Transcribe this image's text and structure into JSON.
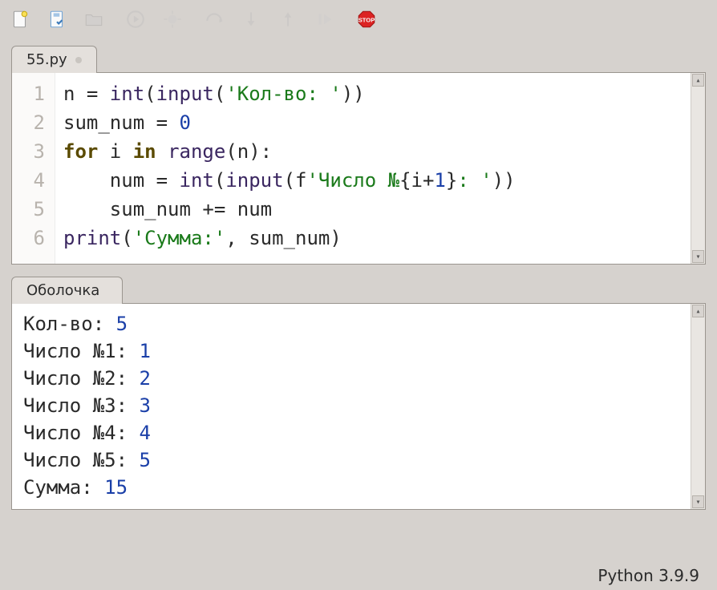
{
  "editor": {
    "tab_label": "55.py",
    "lines_count": 6,
    "tokens": [
      [
        {
          "t": "n = ",
          "c": ""
        },
        {
          "t": "int",
          "c": "fn"
        },
        {
          "t": "(",
          "c": ""
        },
        {
          "t": "input",
          "c": "fn"
        },
        {
          "t": "(",
          "c": ""
        },
        {
          "t": "'Кол-во: '",
          "c": "str"
        },
        {
          "t": "))",
          "c": ""
        }
      ],
      [
        {
          "t": "sum_num = ",
          "c": ""
        },
        {
          "t": "0",
          "c": "num"
        }
      ],
      [
        {
          "t": "for",
          "c": "kw"
        },
        {
          "t": " i ",
          "c": ""
        },
        {
          "t": "in",
          "c": "kw"
        },
        {
          "t": " ",
          "c": ""
        },
        {
          "t": "range",
          "c": "fn"
        },
        {
          "t": "(n):",
          "c": ""
        }
      ],
      [
        {
          "t": "    num = ",
          "c": ""
        },
        {
          "t": "int",
          "c": "fn"
        },
        {
          "t": "(",
          "c": ""
        },
        {
          "t": "input",
          "c": "fn"
        },
        {
          "t": "(f",
          "c": ""
        },
        {
          "t": "'Число №",
          "c": "str"
        },
        {
          "t": "{i+",
          "c": ""
        },
        {
          "t": "1",
          "c": "num"
        },
        {
          "t": "}",
          "c": ""
        },
        {
          "t": ": '",
          "c": "str"
        },
        {
          "t": "))",
          "c": ""
        }
      ],
      [
        {
          "t": "    sum_num += num",
          "c": ""
        }
      ],
      [
        {
          "t": "print",
          "c": "fn"
        },
        {
          "t": "(",
          "c": ""
        },
        {
          "t": "'Сумма:'",
          "c": "str"
        },
        {
          "t": ", sum_num)",
          "c": ""
        }
      ]
    ]
  },
  "shell": {
    "tab_label": "Оболочка",
    "lines": [
      {
        "prompt": "Кол-во:",
        "value": "5"
      },
      {
        "prompt": "Число №1:",
        "value": "1"
      },
      {
        "prompt": "Число №2:",
        "value": "2"
      },
      {
        "prompt": "Число №3:",
        "value": "3"
      },
      {
        "prompt": "Число №4:",
        "value": "4"
      },
      {
        "prompt": "Число №5:",
        "value": "5"
      },
      {
        "prompt": "Сумма:",
        "value": "15"
      }
    ]
  },
  "status": {
    "python_version": "Python 3.9.9"
  },
  "toolbar": {
    "icons": [
      "new-file-icon",
      "save-icon",
      "folder-icon",
      "run-icon",
      "debug-icon",
      "step-over-icon",
      "step-into-icon",
      "step-out-icon",
      "resume-icon",
      "stop-icon"
    ]
  }
}
